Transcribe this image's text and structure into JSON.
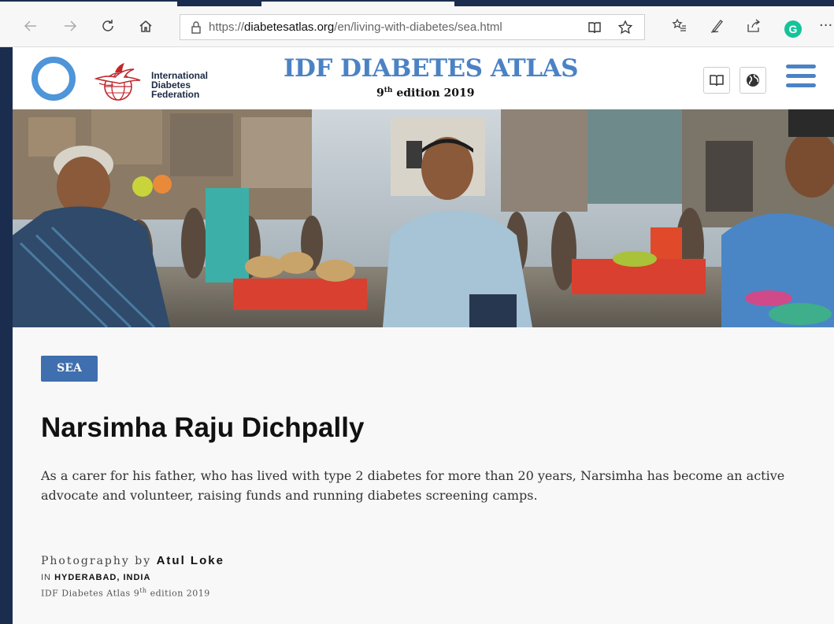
{
  "browser": {
    "url_prefix": "https://",
    "url_domain": "diabetesatlas.org",
    "url_path": "/en/living-with-diabetes/sea.html",
    "icons": [
      "back-icon",
      "forward-icon",
      "refresh-icon",
      "home-icon",
      "lock-icon",
      "reading-view-icon",
      "favorite-star-icon",
      "favorites-list-icon",
      "pen-icon",
      "share-icon",
      "grammarly-icon",
      "more-icon"
    ],
    "grammarly_letter": "G",
    "more_glyph": "···"
  },
  "header": {
    "org_line1": "International",
    "org_line2": "Diabetes",
    "org_line3": "Federation",
    "title": "IDF DIABETES ATLAS",
    "edition_num": "9",
    "edition_sup": "th",
    "edition_rest": " edition 2019",
    "accent_color": "#4b82c4"
  },
  "article": {
    "region_badge": "SEA",
    "name": "Narsimha Raju Dichpally",
    "summary": "As a carer for his father, who has lived with type 2 diabetes for more than 20 years, Narsimha has become an active advocate and volunteer, raising funds and running diabetes screening camps.",
    "credit_prefix": "Photography by ",
    "photographer": "Atul Loke",
    "location_prefix": "IN ",
    "location": "HYDERABAD, INDIA",
    "edition_line_pre": "IDF Diabetes Atlas 9",
    "edition_line_sup": "th",
    "edition_line_post": " edition 2019"
  }
}
